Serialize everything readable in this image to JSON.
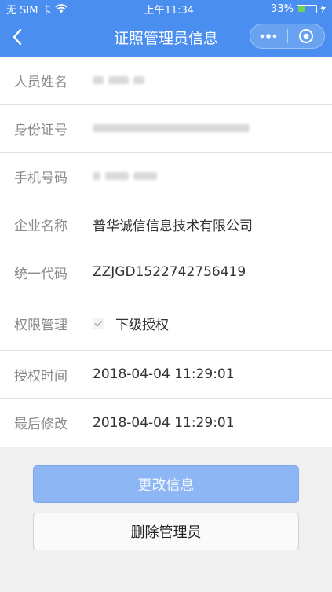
{
  "status_bar": {
    "carrier": "无 SIM 卡",
    "time": "上午11:34",
    "battery": "33%"
  },
  "nav": {
    "title": "证照管理员信息"
  },
  "fields": {
    "name_label": "人员姓名",
    "id_label": "身份证号",
    "phone_label": "手机号码",
    "company_label": "企业名称",
    "company_value": "普华诚信信息技术有限公司",
    "code_label": "统一代码",
    "code_value": "ZZJGD1522742756419",
    "perm_label": "权限管理",
    "perm_value": "下级授权",
    "auth_time_label": "授权时间",
    "auth_time_value": "2018-04-04 11:29:01",
    "modified_label": "最后修改",
    "modified_value": "2018-04-04 11:29:01"
  },
  "buttons": {
    "edit": "更改信息",
    "delete": "删除管理员"
  }
}
